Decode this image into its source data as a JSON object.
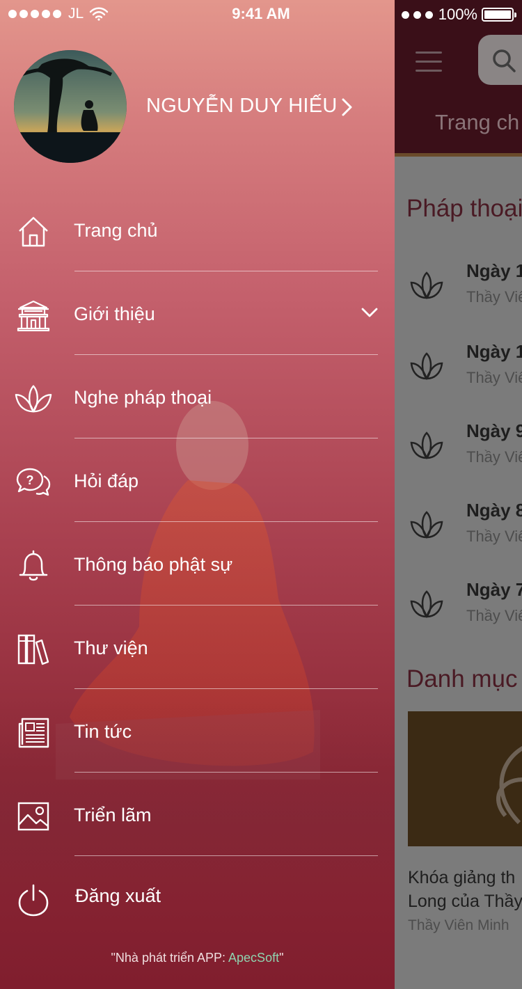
{
  "status_bar": {
    "carrier": "JL",
    "time": "9:41 AM",
    "battery": "100%"
  },
  "profile": {
    "name": "NGUYỄN DUY HIẾU"
  },
  "menu": [
    {
      "label": "Trang chủ",
      "icon": "home-icon"
    },
    {
      "label": "Giới thiệu",
      "icon": "temple-icon"
    },
    {
      "label": "Nghe pháp thoại",
      "icon": "lotus-icon"
    },
    {
      "label": "Hỏi đáp",
      "icon": "question-chat-icon"
    },
    {
      "label": "Thông báo phật sự",
      "icon": "bell-icon"
    },
    {
      "label": "Thư viện",
      "icon": "books-icon"
    },
    {
      "label": "Tin tức",
      "icon": "newspaper-icon"
    },
    {
      "label": "Triển lãm",
      "icon": "image-icon"
    },
    {
      "label": "Đăng xuất",
      "icon": "power-icon"
    }
  ],
  "footer": {
    "prefix": "\"Nhà phát triển APP: ",
    "brand": "ApecSoft",
    "suffix": "\""
  },
  "main": {
    "tab": "Trang ch",
    "section_phap_thoai": "Pháp thoại",
    "items": [
      {
        "title": "Ngày 1",
        "sub": "Thầy Viê"
      },
      {
        "title": "Ngày 1",
        "sub": "Thầy Viê"
      },
      {
        "title": "Ngày 9",
        "sub": "Thầy Viê"
      },
      {
        "title": "Ngày 8",
        "sub": "Thầy Viê"
      },
      {
        "title": "Ngày 7",
        "sub": "Thầy Viê"
      }
    ],
    "section_danh_muc": "Danh mục",
    "card_line1": "Khóa giảng th",
    "card_line2": "Long của Thầy",
    "card_author": "Thầy Viên Minh"
  },
  "colors": {
    "drawer_top": "#e3968c",
    "drawer_bottom": "#801e2e",
    "brand_link": "#8fd4b0",
    "header_dark": "#3a0f18"
  }
}
